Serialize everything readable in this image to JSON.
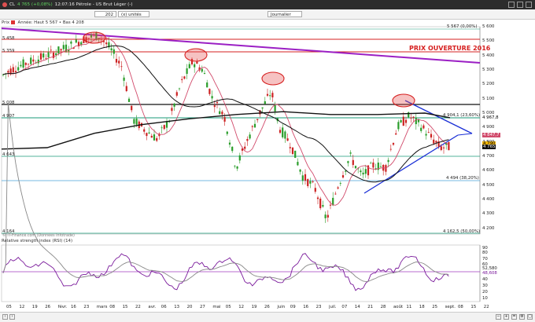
{
  "header": {
    "symbol": "CL",
    "price_change": "4 765 (+0,08%)",
    "title": "12:07:16 Pétrole - US Brut Léger (-)"
  },
  "toolbar": {
    "interval_value": "202",
    "units": "(x) unités",
    "period": "Journalier"
  },
  "info": {
    "prefix": "Prix",
    "text": "Année: Haut 5 567 • Bas 4 208"
  },
  "annotations": {
    "opening_price": "PRIX OUVERTURE 2016"
  },
  "levels": [
    {
      "label": "5 567 (0,00%)"
    },
    {
      "label": "4 904,1 (23,60%)"
    },
    {
      "label": "4 494 (38,20%)"
    },
    {
      "label": "4 162,5 (50,00%)"
    }
  ],
  "left_labels": [
    "5 458",
    "5 359",
    "5 008",
    "4 907",
    "4 643",
    "4 164"
  ],
  "right_axis": [
    "5 600",
    "5 500",
    "5 400",
    "5 300",
    "5 200",
    "5 100",
    "5 000",
    "4 967,8",
    "4 900",
    "4 847,7",
    "4 800",
    "4 790",
    "4 765",
    "4 700",
    "4 600",
    "4 500",
    "4 400",
    "4 300",
    "4 200"
  ],
  "rsi": {
    "title": "Relative strength index (RSI) (14)",
    "axis": [
      "90",
      "80",
      "70",
      "60",
      "52,580",
      "48,608",
      "40",
      "30",
      "20",
      "10"
    ]
  },
  "credit": "© IT-Finance.com (Données Infotrade)",
  "x_axis": [
    "05",
    "12",
    "19",
    "26",
    "févr.",
    "16",
    "23",
    "mars",
    "08",
    "15",
    "22",
    "avr.",
    "06",
    "13",
    "20",
    "27",
    "mai",
    "05",
    "12",
    "19",
    "26",
    "juin",
    "09",
    "16",
    "23",
    "juil.",
    "07",
    "14",
    "21",
    "28",
    "août",
    "11",
    "18",
    "25",
    "sept.",
    "08",
    "15",
    "22"
  ],
  "colors": {
    "bull": "#2a9d2a",
    "bear": "#cc2222",
    "sma_short": "#d14a6b",
    "sma_long": "#111111",
    "trend_purple": "#9b1fc4",
    "triangle": "#1a2fd6",
    "fib": "#1a9a7a",
    "red_level": "#d62020"
  }
}
